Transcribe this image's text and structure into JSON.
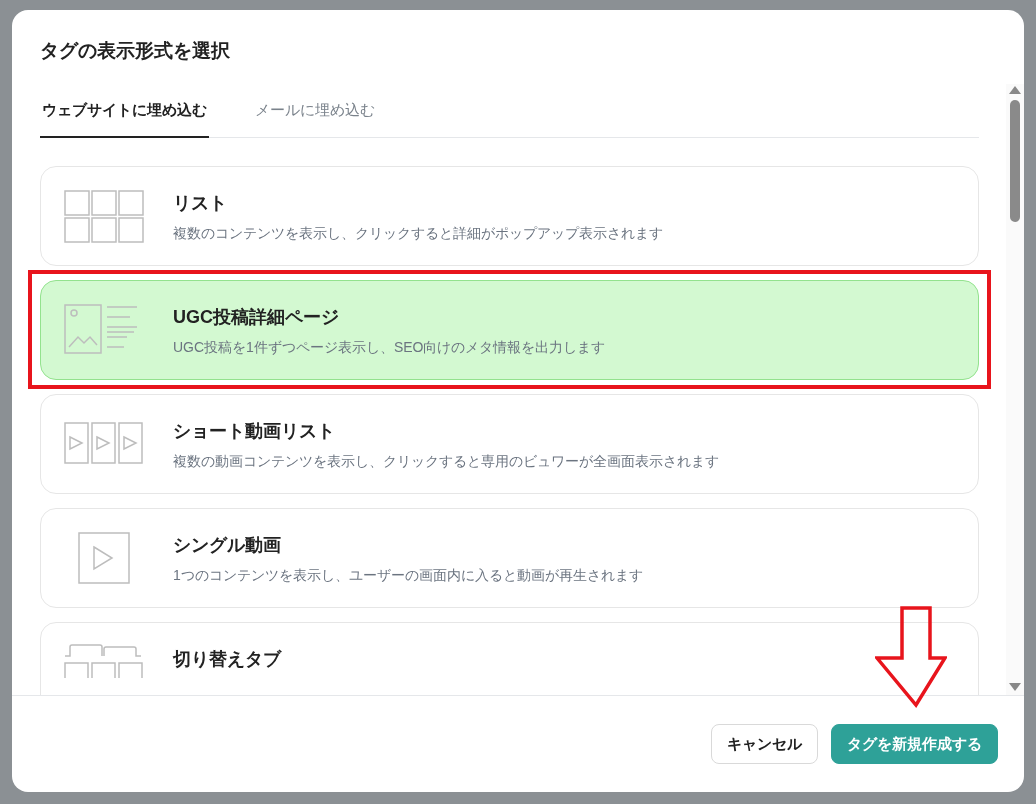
{
  "dialog": {
    "title": "タグの表示形式を選択",
    "tabs": [
      {
        "label": "ウェブサイトに埋め込む",
        "selected": true
      },
      {
        "label": "メールに埋め込む",
        "selected": false
      }
    ],
    "formats": [
      {
        "kind": "grid",
        "title": "リスト",
        "description": "複数のコンテンツを表示し、クリックすると詳細がポップアップ表示されます",
        "selected": false
      },
      {
        "kind": "detail",
        "title": "UGC投稿詳細ページ",
        "description": "UGC投稿を1件ずつページ表示し、SEO向けのメタ情報を出力します",
        "selected": true
      },
      {
        "kind": "video-list",
        "title": "ショート動画リスト",
        "description": "複数の動画コンテンツを表示し、クリックすると専用のビュワーが全画面表示されます",
        "selected": false
      },
      {
        "kind": "single-video",
        "title": "シングル動画",
        "description": "1つのコンテンツを表示し、ユーザーの画面内に入ると動画が再生されます",
        "selected": false
      },
      {
        "kind": "tabs",
        "title": "切り替えタブ",
        "selected": false
      }
    ],
    "buttons": [
      {
        "kind": "secondary",
        "label": "キャンセル"
      },
      {
        "kind": "primary",
        "label": "タグを新規作成する"
      }
    ]
  }
}
